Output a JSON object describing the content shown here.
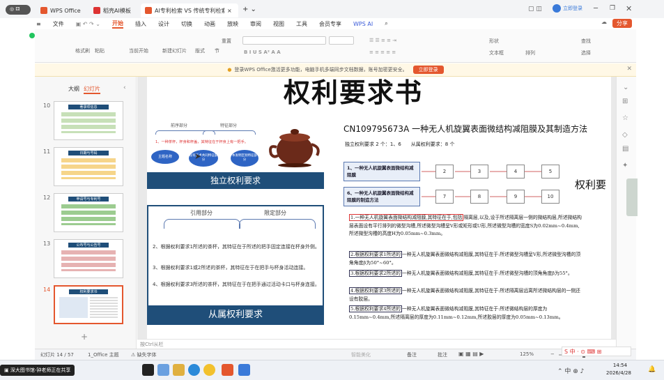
{
  "titlebar": {
    "tabs": [
      {
        "label": "WPS Office",
        "color": "#e4572e"
      },
      {
        "label": "稻壳AI模板",
        "color": "#d33"
      },
      {
        "label": "AI专利检索 VS 传统专利检索",
        "color": "#e4572e"
      }
    ],
    "login": "立即登录",
    "viewer_count": "328"
  },
  "ribbon": {
    "file": "文件",
    "tabs": [
      "开始",
      "插入",
      "设计",
      "切换",
      "动画",
      "放映",
      "审阅",
      "视图",
      "工具",
      "会员专享",
      "WPS AI"
    ],
    "active": "开始",
    "share": "分享",
    "tools": {
      "format_brush": "格式刷",
      "paste": "粘贴",
      "play_current": "当前开始",
      "new_slide": "新建幻灯片",
      "layout": "版式",
      "section": "节",
      "reset": "重置",
      "shape": "形状",
      "arrange": "排列",
      "find": "查找",
      "select": "选择",
      "textbox": "文本框"
    }
  },
  "notice": {
    "text": "登录WPS Office激活更多功能，电脑手机多端同步文档数据，账号加密更安全。",
    "button": "立即登录"
  },
  "leftpane": {
    "tabs": [
      "大纲",
      "幻灯片"
    ],
    "slides": [
      {
        "num": "10",
        "title": "著录项信息"
      },
      {
        "num": "11",
        "title": "日期与号码"
      },
      {
        "num": "12",
        "title": "申请号与专利号"
      },
      {
        "num": "13",
        "title": "公布号与公告号"
      },
      {
        "num": "14",
        "title": "权利要求书"
      }
    ],
    "add": "+"
  },
  "slide": {
    "title": "权利要求书",
    "left": {
      "labels": {
        "prefix": "前序部分",
        "feature": "特征部分"
      },
      "sample": "1、一种茶杯，杯身和杯盖，其特征在于杯身上有一把手。",
      "bubbles": [
        "主题名称",
        "现有技术共同特征部分",
        "本发明区别特征部分"
      ],
      "banner_top": "独立权利要求",
      "quote": "引用部分",
      "limit": "限定部分",
      "claims": [
        "2、根据权利要求1所述的茶杯，其特征在于所述的把手固定连接在杯身外侧。",
        "3、根据权利要求1或2所述的茶杯，其特征在于在把手与杯身活动连接。",
        "4、根据权利要求3所述的茶杯，其特征在于在把手通过活动卡口与杯身连接。"
      ],
      "banner_bottom": "从属权利要求"
    },
    "right": {
      "patent_title": "CN109795673A 一种无人机旋翼表面微结构减阻膜及其制造方法",
      "counts": "独立权利要求 2 个：1、6　　从属权利要求：8 个",
      "side_label": "权利要",
      "rows": [
        {
          "label": "1、一种无人机旋翼表面微结构减阻膜",
          "nums": [
            "2",
            "3",
            "4",
            "5"
          ]
        },
        {
          "label": "6、一种无人机旋翼表面微结构减阻膜的制造方法",
          "nums": [
            "7",
            "8",
            "9",
            "10"
          ]
        }
      ],
      "paras": [
        {
          "hl": "1.一种无人机旋翼表面微结构减阻膜,其特征在于,包括",
          "rest": "隔离层,以及,设于所述隔离层一侧的微结构层,所述微结构层表面设有平行排列的微型沟槽,所述微型沟槽呈V形或矩形或U形,所述微型沟槽的宽度S为0.02mm~0.4mm,所述微型沟槽的高度H为0.05mm~0.3mm。",
          "type": "r"
        },
        {
          "hl": "2.根据权利要求1所述的",
          "rest": "一种无人机旋翼表面微结构减阻膜,其特征在于:所述微型沟槽呈V形,所述微型沟槽的顶角角度β为50°~60°。",
          "type": "b"
        },
        {
          "hl": "3.根据权利要求2所述的",
          "rest": "一种无人机旋翼表面微结构减阻膜,其特征在于:所述微型沟槽的顶角角度β为55°。",
          "type": "b"
        },
        {
          "hl": "4.根据权利要求3所述的",
          "rest": "一种无人机旋翼表面微结构减阻膜,其特征在于:所述隔离层远离所述微结构层的一侧还设有胶层。",
          "type": "b"
        },
        {
          "hl": "5.根据权利要求4所述的",
          "rest": "一种无人机旋翼表面微结构减阻膜,其特征在于:所述微结构层的厚度为0.15mm~0.4mm,所述隔离层的厚度为0.11mm~0.12mm,所述胶层的厚度为0.05mm~0.13mm。",
          "type": "b"
        }
      ]
    }
  },
  "notes": "按Ctrl从栏",
  "status": {
    "slide": "幻灯片 14 / 57",
    "theme": "1_Office 主题",
    "font": "缺失字体",
    "smart": "智能美化",
    "notes": "备注",
    "comment": "批注",
    "zoom": "125%"
  },
  "taskbar": {
    "share": "深大图书馆-钟老师正在共享",
    "time": "14:54",
    "date": "2026/4/28"
  },
  "colors": {
    "accent": "#e4572e",
    "banner": "#1f4e79"
  }
}
